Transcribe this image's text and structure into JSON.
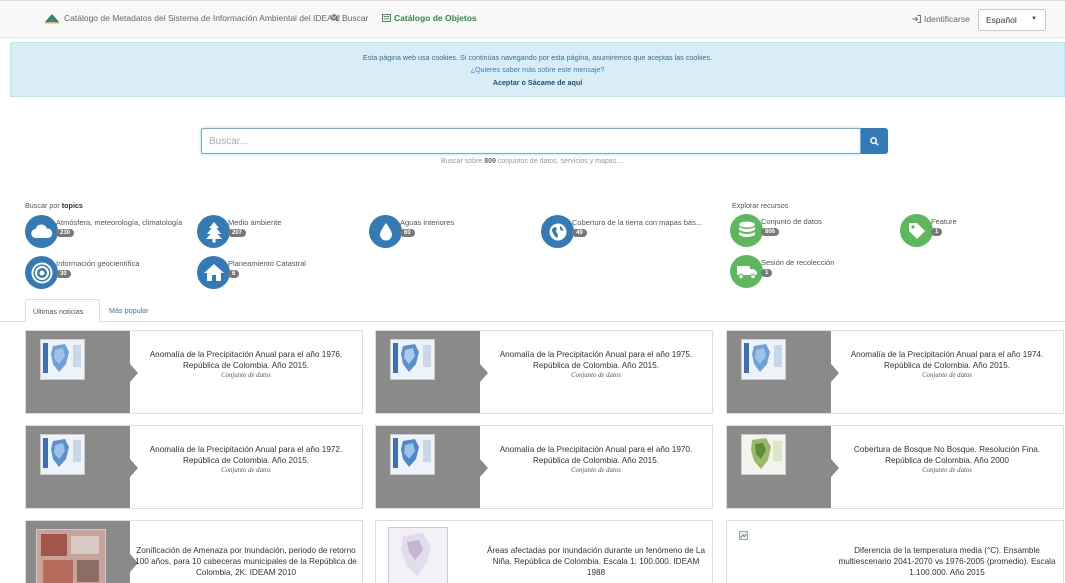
{
  "header": {
    "brand": "Catálogo de Metadatos del Sistema de Información Ambiental del IDEAM",
    "search_link": "Buscar",
    "catalog_link": "Catálogo de Objetos",
    "login": "Identificarse",
    "language": "Español"
  },
  "cookie": {
    "message": "Esta página web usa cookies. Si continúas navegando por esta página, asumiremos que aceptas las cookies.",
    "more": "¿Quieres saber más sobre este mensaje?",
    "accept": "Aceptar",
    "or": "o",
    "leave": "Sácame de aquí"
  },
  "search": {
    "placeholder": "Buscar...",
    "hint_prefix": "Buscar sobre",
    "hint_count": "809",
    "hint_suffix": "conjuntos de datos, servicios y mapas,..."
  },
  "topics": {
    "label_prefix": "Buscar por",
    "label_bold": "topics",
    "items": [
      {
        "label": "Atmósfera, meteorología, climatología",
        "count": "230",
        "icon": "cloud-icon"
      },
      {
        "label": "Medio ambiente",
        "count": "207",
        "icon": "tree-icon"
      },
      {
        "label": "Aguas interiores",
        "count": "60",
        "icon": "water-drop-icon"
      },
      {
        "label": "Cobertura de la tierra con mapas bás...",
        "count": "49",
        "icon": "globe-icon"
      },
      {
        "label": "Información geocientífica",
        "count": "30",
        "icon": "target-icon"
      },
      {
        "label": "Planeamiento Catastral",
        "count": "6",
        "icon": "house-icon"
      }
    ]
  },
  "resources": {
    "label": "Explorar recursos",
    "items": [
      {
        "label": "Conjunto de datos",
        "count": "806",
        "icon": "database-icon"
      },
      {
        "label": "Feature",
        "count": "1",
        "icon": "tag-icon"
      },
      {
        "label": "Sesión de recolección",
        "count": "1",
        "icon": "truck-icon"
      }
    ]
  },
  "tabs": {
    "latest": "Últimas noticias",
    "popular": "Más popular"
  },
  "cards": [
    {
      "title": "Anomalía de la Precipitación Anual para el año 1976. República de Colombia. Año 2015.",
      "type": "Conjunto de datos"
    },
    {
      "title": "Anomalía de la Precipitación Anual para el año 1975. República de Colombia. Año 2015.",
      "type": "Conjunto de datos"
    },
    {
      "title": "Anomalía de la Precipitación Anual para el año 1974. República de Colombia. Año 2015.",
      "type": "Conjunto de datos"
    },
    {
      "title": "Anomalía de la Precipitación Anual para el año 1972. República de Colombia. Año 2015.",
      "type": "Conjunto de datos"
    },
    {
      "title": "Anomalía de la Precipitación Anual para el año 1970. República de Colombia. Año 2015.",
      "type": "Conjunto de datos"
    },
    {
      "title": "Cobertura de Bosque No Bosque. Resolución Fina. República de Colombia. Año 2000",
      "type": "Conjunto de datos"
    },
    {
      "title": "Zonificación de Amenaza por Inundación, periodo de retorno 100 años, para 10 cabeceras municipales de la República de Colombia, 2K. IDEAM 2010",
      "type": ""
    },
    {
      "title": "Áreas afectadas por inundación durante un fenómeno de La Niña. República de Colombia. Escala 1: 100.000. IDEAM 1988",
      "type": ""
    },
    {
      "title": "Diferencia de la temperatura media (°C). Ensamble multiescenario 2041-2070 vs 1976-2005 (promedio). Escala 1.100.000. Año 2015",
      "type": ""
    }
  ],
  "colors": {
    "accent_blue": "#337ab7",
    "accent_green": "#5cb85c",
    "catalog_green": "#2e8b3a",
    "cookie_bg": "#d9edf7"
  }
}
